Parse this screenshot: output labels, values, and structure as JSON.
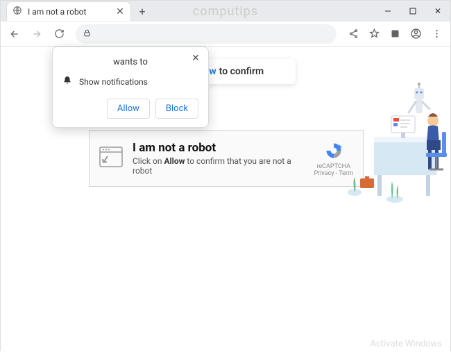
{
  "watermark": "computips",
  "tab": {
    "title": "I am not a robot"
  },
  "banner": {
    "allow": "Allow",
    "rest": "to confirm"
  },
  "permission": {
    "wants_to": "wants to",
    "show_notifications": "Show notifications",
    "allow": "Allow",
    "block": "Block"
  },
  "captcha": {
    "heading": "I am not a robot",
    "sub_prefix": "Click on ",
    "sub_bold": "Allow",
    "sub_suffix": " to confirm that you are not a robot",
    "brand": "reCAPTCHA",
    "legal": "Privacy - Term"
  },
  "footer": {
    "activate": "Activate Windows"
  }
}
